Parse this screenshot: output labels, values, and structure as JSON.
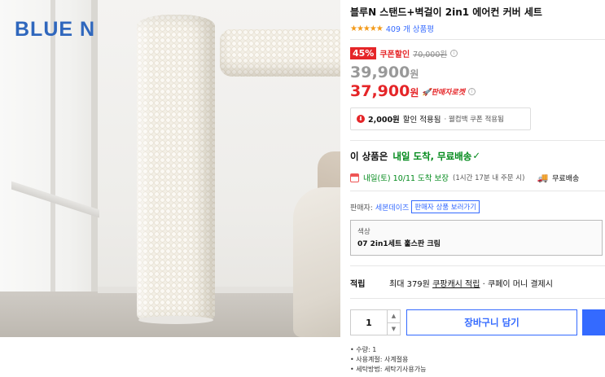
{
  "brand_logo": "BLUE N",
  "product": {
    "title": "블루N 스탠드+벽걸이 2in1 에어컨 커버 세트",
    "stars": "★★★★★",
    "review_count": "409 개 상품평"
  },
  "pricing": {
    "discount_percent": "45%",
    "coupon_label": "쿠폰할인",
    "original_price": "70,000원",
    "info_icon": "i",
    "sale_price": "39,900",
    "sale_unit": "원",
    "final_price": "37,900",
    "final_unit": "원",
    "seller_rocket_badge": "🚀판매자로켓"
  },
  "discount_info": {
    "icon": "⬇",
    "amount": "2,000원",
    "text": "할인 적용됨",
    "note": "· 웰컴백 쿠폰 적용됨"
  },
  "delivery": {
    "prefix": "이 상품은",
    "highlight": "내일 도착, 무료배송",
    "check": "✓",
    "date_text": "내일(토) 10/11 도착 보장",
    "date_note": "(1시간 17분 내 주문 시)",
    "ship_icon": "🚚",
    "ship_text": "무료배송"
  },
  "seller": {
    "label": "판매자:",
    "name": "세본데이즈",
    "link": "판매자 상품 보러가기"
  },
  "option": {
    "label": "색상",
    "value": "07 2in1세트 훌스판 크림"
  },
  "reward": {
    "label": "적립",
    "text_prefix": "최대 379원",
    "text_link": "쿠팡캐시 적립",
    "text_suffix": "· 쿠페이 머니 결제시"
  },
  "purchase": {
    "quantity": "1",
    "up_arrow": "▲",
    "down_arrow": "▼",
    "cart_button": "장바구니 담기"
  },
  "specs": [
    "수량: 1",
    "사용계절: 사계절용",
    "세탁방법: 세탁기사용가능"
  ],
  "colors": {
    "accent_blue": "#346aff",
    "price_red": "#e52528",
    "delivery_green": "#00891a",
    "star_orange": "#f39a1a"
  }
}
